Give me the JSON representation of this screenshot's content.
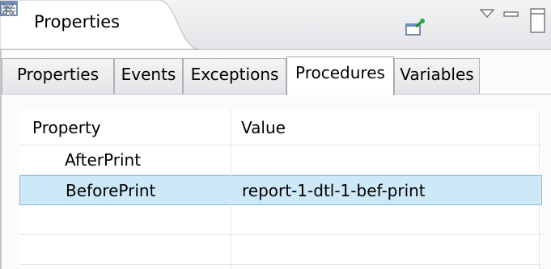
{
  "view": {
    "title": "Properties",
    "tab_icon": "properties-view-icon",
    "close_icon": "close-icon",
    "toolbar_icons": [
      "pin-icon",
      "view-menu-icon",
      "minimize-icon",
      "maximize-icon"
    ]
  },
  "tabs": [
    {
      "label": "Properties",
      "active": false
    },
    {
      "label": "Events",
      "active": false
    },
    {
      "label": "Exceptions",
      "active": false
    },
    {
      "label": "Procedures",
      "active": true
    },
    {
      "label": "Variables",
      "active": false
    }
  ],
  "table": {
    "columns": [
      "Property",
      "Value"
    ],
    "rows": [
      {
        "property": "AfterPrint",
        "value": "",
        "selected": false
      },
      {
        "property": "BeforePrint",
        "value": "report-1-dtl-1-bef-print",
        "selected": true
      },
      {
        "property": "",
        "value": "",
        "selected": false
      },
      {
        "property": "",
        "value": "",
        "selected": false
      }
    ]
  },
  "colors": {
    "selection_fill": "#cde8f7",
    "selection_border": "#7fbde2"
  }
}
